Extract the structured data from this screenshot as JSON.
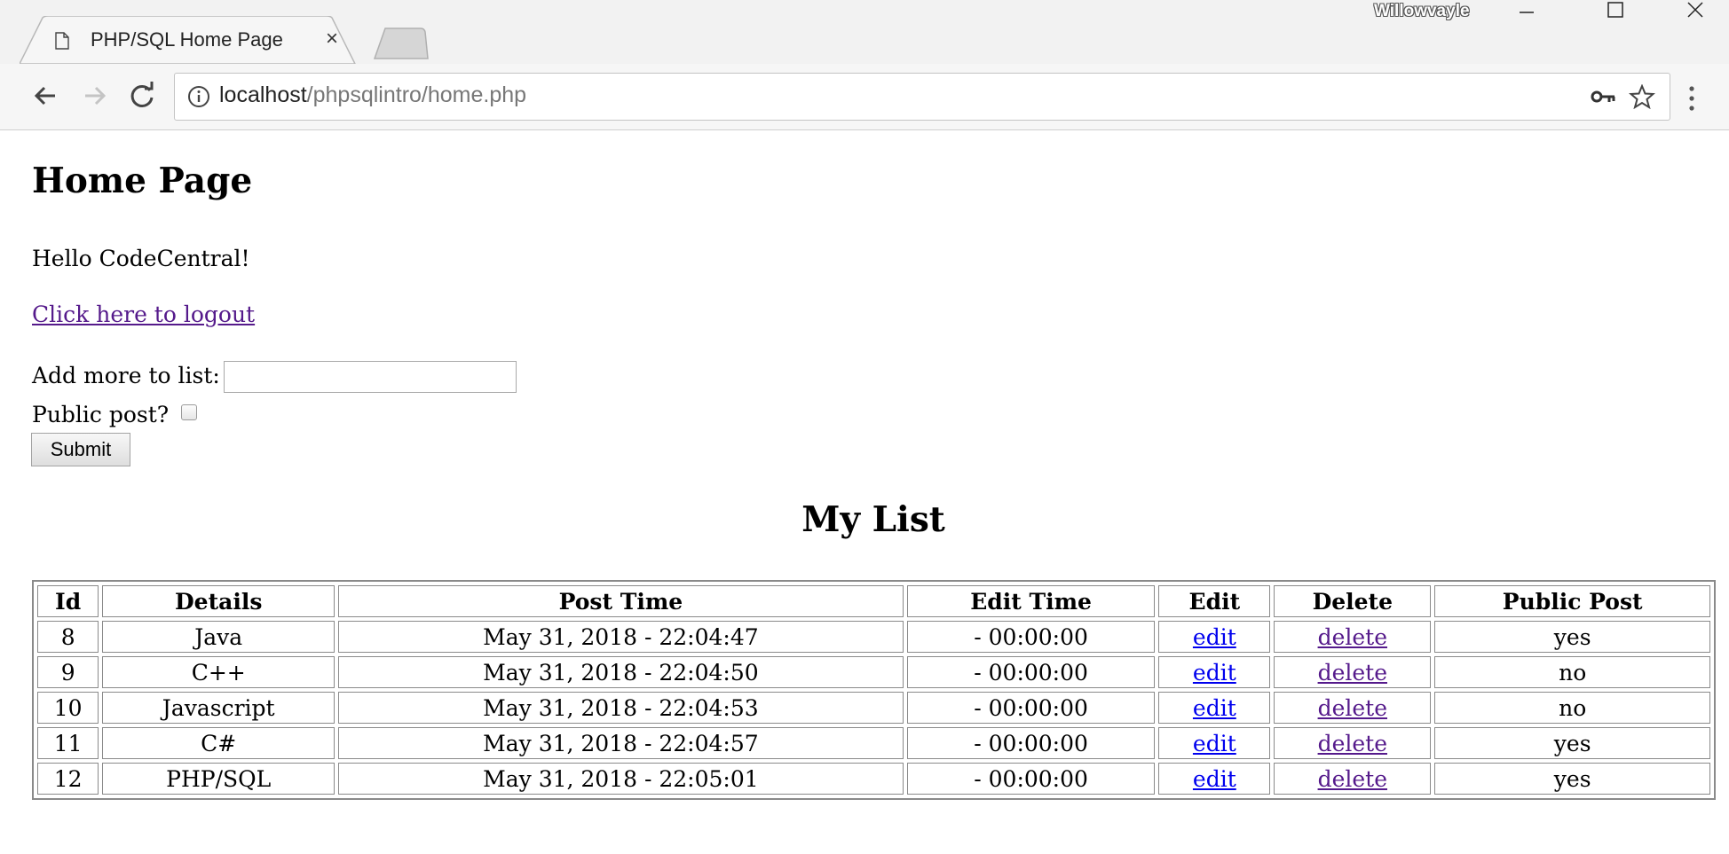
{
  "browser": {
    "tab_title": "PHP/SQL Home Page",
    "tab_close": "×",
    "profile_name": "Willowvayle",
    "url_host": "localhost",
    "url_path": "/phpsqlintro/home.php"
  },
  "page": {
    "heading": "Home Page",
    "greeting": "Hello CodeCentral!",
    "logout_link": "Click here to logout",
    "add_label": "Add more to list:",
    "add_value": "",
    "public_label": "Public post?",
    "submit_label": "Submit",
    "list_title": "My List"
  },
  "table": {
    "headers": [
      "Id",
      "Details",
      "Post Time",
      "Edit Time",
      "Edit",
      "Delete",
      "Public Post"
    ],
    "rows": [
      {
        "id": "8",
        "details": "Java",
        "post_time": "May 31, 2018 - 22:04:47",
        "edit_time": "- 00:00:00",
        "edit": "edit",
        "delete": "delete",
        "public": "yes"
      },
      {
        "id": "9",
        "details": "C++",
        "post_time": "May 31, 2018 - 22:04:50",
        "edit_time": "- 00:00:00",
        "edit": "edit",
        "delete": "delete",
        "public": "no"
      },
      {
        "id": "10",
        "details": "Javascript",
        "post_time": "May 31, 2018 - 22:04:53",
        "edit_time": "- 00:00:00",
        "edit": "edit",
        "delete": "delete",
        "public": "no"
      },
      {
        "id": "11",
        "details": "C#",
        "post_time": "May 31, 2018 - 22:04:57",
        "edit_time": "- 00:00:00",
        "edit": "edit",
        "delete": "delete",
        "public": "yes"
      },
      {
        "id": "12",
        "details": "PHP/SQL",
        "post_time": "May 31, 2018 - 22:05:01",
        "edit_time": "- 00:00:00",
        "edit": "edit",
        "delete": "delete",
        "public": "yes"
      }
    ]
  },
  "colors": {
    "link_unvisited": "#0000ee",
    "link_visited": "#551a8b",
    "chrome_bg": "#f2f2f2"
  },
  "icons": [
    "page-icon",
    "close-icon",
    "minimize-icon",
    "maximize-icon",
    "window-close-icon",
    "back-arrow-icon",
    "forward-arrow-icon",
    "reload-icon",
    "info-icon",
    "key-icon",
    "star-icon",
    "menu-icon"
  ]
}
